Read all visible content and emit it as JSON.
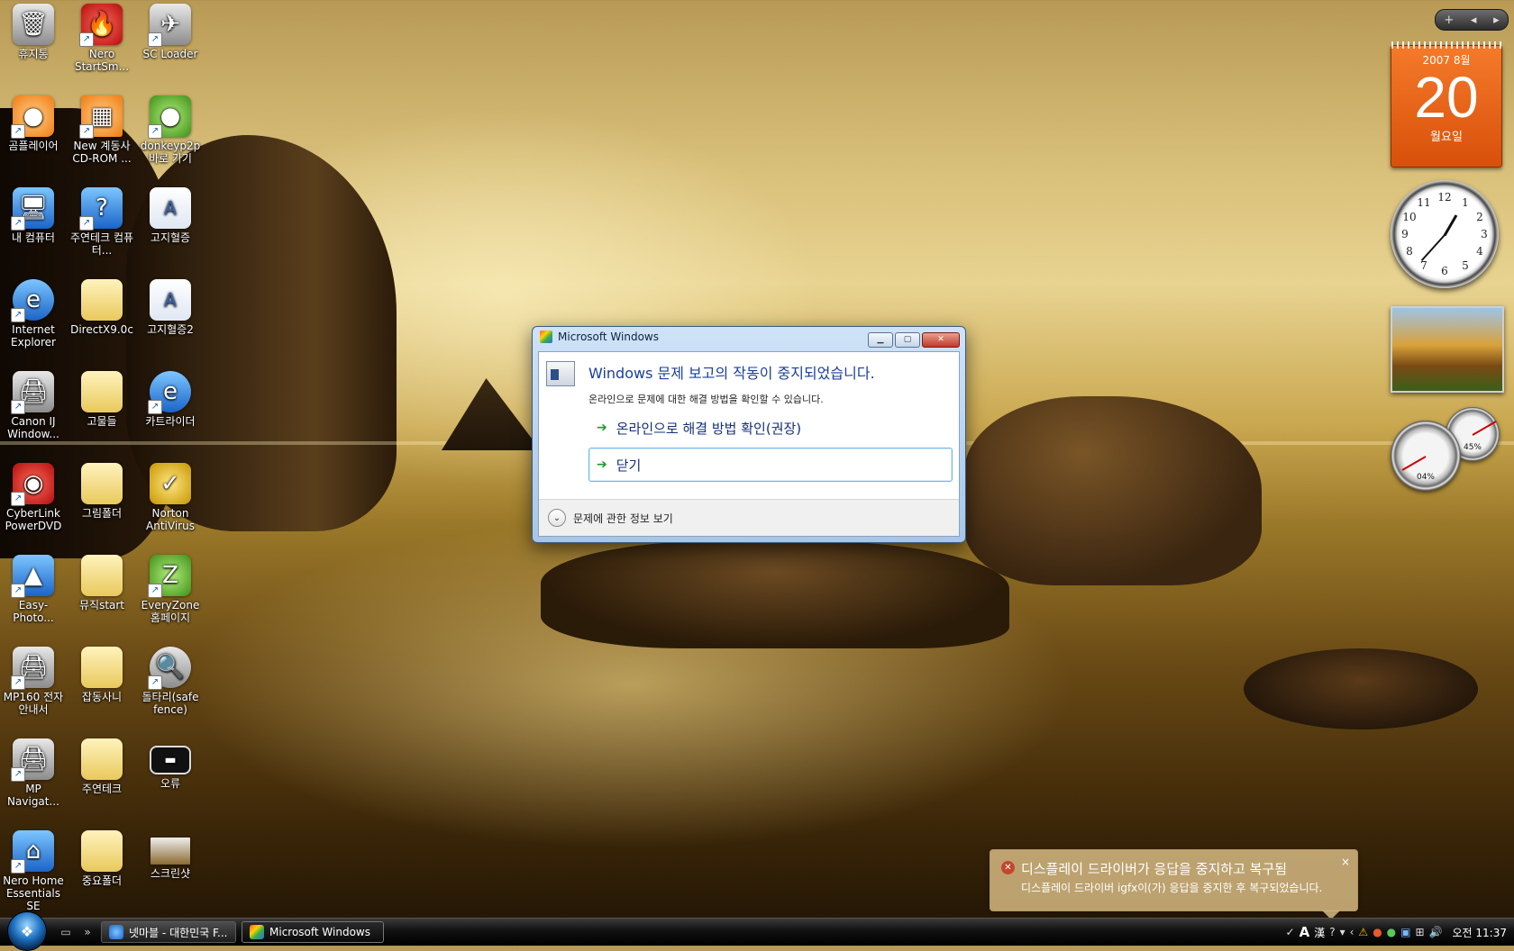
{
  "desktop_icons": [
    {
      "label": "휴지통",
      "icon": "recycle-bin-icon"
    },
    {
      "label": "Nero StartSm...",
      "icon": "nero-icon"
    },
    {
      "label": "SC Loader",
      "icon": "sc-loader-icon"
    },
    {
      "label": "곰플레이어",
      "icon": "gom-player-icon"
    },
    {
      "label": "New 계동사 CD-ROM ...",
      "icon": "cdrom-icon"
    },
    {
      "label": "donkeyp2p 바로 가기",
      "icon": "donkey-icon"
    },
    {
      "label": "내 컴퓨터",
      "icon": "computer-icon"
    },
    {
      "label": "주연테크 컴퓨터...",
      "icon": "help-icon"
    },
    {
      "label": "고지혈증",
      "icon": "document-icon"
    },
    {
      "label": "Internet Explorer",
      "icon": "ie-icon"
    },
    {
      "label": "DirectX9.0c",
      "icon": "folder-icon"
    },
    {
      "label": "고지혈증2",
      "icon": "document-icon"
    },
    {
      "label": "Canon IJ Window...",
      "icon": "printer-icon"
    },
    {
      "label": "고물들",
      "icon": "folder-icon"
    },
    {
      "label": "카트라이더",
      "icon": "ie-icon"
    },
    {
      "label": "CyberLink PowerDVD",
      "icon": "dvd-icon"
    },
    {
      "label": "그림폴더",
      "icon": "folder-icon"
    },
    {
      "label": "Norton AntiVirus",
      "icon": "norton-icon"
    },
    {
      "label": "Easy-Photo...",
      "icon": "photo-icon"
    },
    {
      "label": "뮤직start",
      "icon": "folder-icon"
    },
    {
      "label": "EveryZone 홈페이지",
      "icon": "everyzone-icon"
    },
    {
      "label": "MP160 전자 안내서",
      "icon": "printer-icon"
    },
    {
      "label": "잡동사니",
      "icon": "folder-icon"
    },
    {
      "label": "돌타리(safe fence)",
      "icon": "magnifier-icon"
    },
    {
      "label": "MP Navigat...",
      "icon": "printer-icon"
    },
    {
      "label": "주연테크",
      "icon": "folder-icon"
    },
    {
      "label": "오류",
      "icon": "screen-icon"
    },
    {
      "label": "Nero Home Essentials SE",
      "icon": "nero-home-icon"
    },
    {
      "label": "중요폴더",
      "icon": "folder-icon"
    },
    {
      "label": "스크린샷",
      "icon": "screenshot-icon"
    }
  ],
  "sidebar": {
    "plus_label": "+",
    "calendar": {
      "year_month": "2007 8월",
      "day": "20",
      "weekday": "월요일"
    },
    "clock_numbers": [
      "12",
      "1",
      "2",
      "3",
      "4",
      "5",
      "6",
      "7",
      "8",
      "9",
      "10",
      "11"
    ],
    "meter_big_pct": "04%",
    "meter_small_pct": "45%"
  },
  "dialog": {
    "title": "Microsoft Windows",
    "main_instruction": "Windows 문제 보고의 작동이 중지되었습니다.",
    "sub_text": "온라인으로 문제에 대한 해결 방법을 확인할 수 있습니다.",
    "option_online": "온라인으로 해결 방법 확인(권장)",
    "option_close": "닫기",
    "details_label": "문제에 관한 정보 보기"
  },
  "balloon": {
    "title": "디스플레이 드라이버가 응답을 중지하고 복구됨",
    "text": "디스플레이 드라이버 igfx이(가) 응답을 중지한 후 복구되었습니다.",
    "close": "×"
  },
  "taskbar": {
    "chevron": "»",
    "buttons": [
      {
        "label": "넷마블 - 대한민국 F...",
        "active": false
      },
      {
        "label": "Microsoft Windows",
        "active": true
      }
    ],
    "tray_lang": "A",
    "tray_hanja": "漢",
    "time": "오전 11:37"
  }
}
